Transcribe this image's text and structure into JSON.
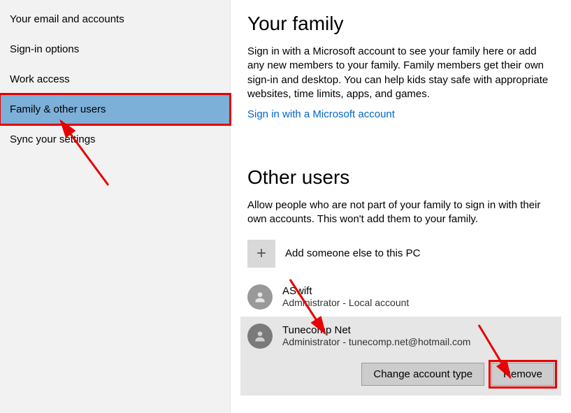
{
  "sidebar": {
    "items": [
      {
        "label": "Your email and accounts",
        "selected": false
      },
      {
        "label": "Sign-in options",
        "selected": false
      },
      {
        "label": "Work access",
        "selected": false
      },
      {
        "label": "Family & other users",
        "selected": true
      },
      {
        "label": "Sync your settings",
        "selected": false
      }
    ]
  },
  "family": {
    "title": "Your family",
    "desc": "Sign in with a Microsoft account to see your family here or add any new members to your family. Family members get their own sign-in and desktop. You can help kids stay safe with appropriate websites, time limits, apps, and games.",
    "link": "Sign in with a Microsoft account"
  },
  "other": {
    "title": "Other users",
    "desc": "Allow people who are not part of your family to sign in with their own accounts. This won't add them to your family.",
    "add_label": "Add someone else to this PC",
    "users": [
      {
        "name": "ASwift",
        "sub": "Administrator - Local account",
        "selected": false
      },
      {
        "name": "Tunecomp Net",
        "sub": "Administrator - tunecomp.net@hotmail.com",
        "selected": true
      }
    ],
    "change_label": "Change account type",
    "remove_label": "Remove"
  }
}
